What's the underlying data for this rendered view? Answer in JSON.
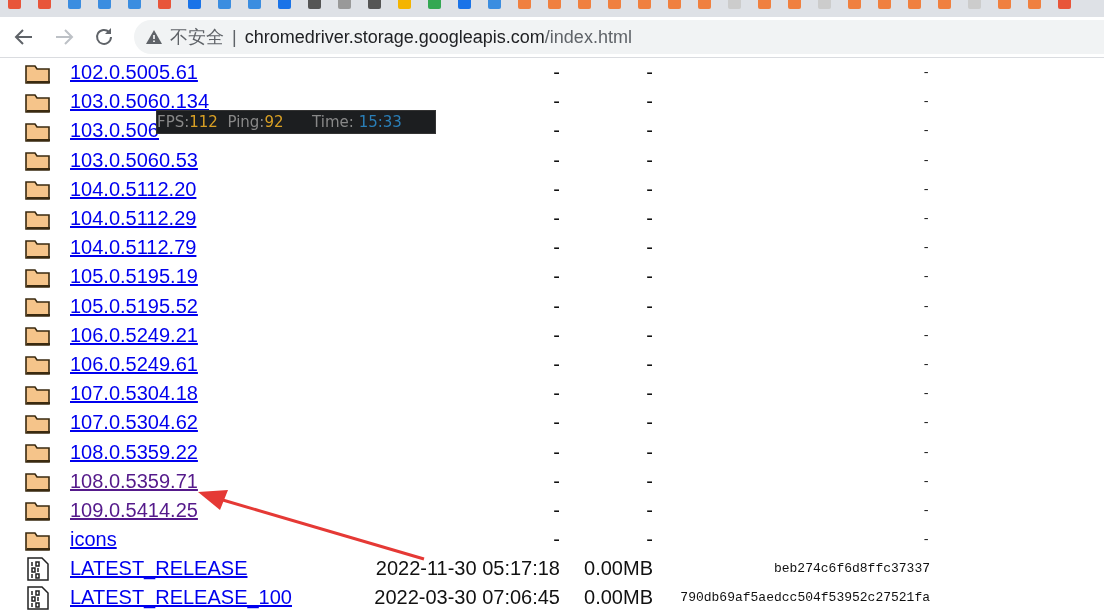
{
  "toolbar": {
    "security_label": "不安全",
    "separator": "|",
    "url_host": "chromedriver.storage.googleapis.com",
    "url_path": "/index.html"
  },
  "rows": [
    {
      "kind": "folder",
      "name": "102.0.5005.61",
      "visited": false,
      "modified": "-",
      "size": "-",
      "hash": "-"
    },
    {
      "kind": "folder",
      "name": "103.0.5060.134",
      "visited": false,
      "modified": "-",
      "size": "-",
      "hash": "-"
    },
    {
      "kind": "folder",
      "name": "103.0.506",
      "visited": false,
      "modified": "-",
      "size": "-",
      "hash": "-"
    },
    {
      "kind": "folder",
      "name": "103.0.5060.53",
      "visited": false,
      "modified": "-",
      "size": "-",
      "hash": "-"
    },
    {
      "kind": "folder",
      "name": "104.0.5112.20",
      "visited": false,
      "modified": "-",
      "size": "-",
      "hash": "-"
    },
    {
      "kind": "folder",
      "name": "104.0.5112.29",
      "visited": false,
      "modified": "-",
      "size": "-",
      "hash": "-"
    },
    {
      "kind": "folder",
      "name": "104.0.5112.79",
      "visited": false,
      "modified": "-",
      "size": "-",
      "hash": "-"
    },
    {
      "kind": "folder",
      "name": "105.0.5195.19",
      "visited": false,
      "modified": "-",
      "size": "-",
      "hash": "-"
    },
    {
      "kind": "folder",
      "name": "105.0.5195.52",
      "visited": false,
      "modified": "-",
      "size": "-",
      "hash": "-"
    },
    {
      "kind": "folder",
      "name": "106.0.5249.21",
      "visited": false,
      "modified": "-",
      "size": "-",
      "hash": "-"
    },
    {
      "kind": "folder",
      "name": "106.0.5249.61",
      "visited": false,
      "modified": "-",
      "size": "-",
      "hash": "-"
    },
    {
      "kind": "folder",
      "name": "107.0.5304.18",
      "visited": false,
      "modified": "-",
      "size": "-",
      "hash": "-"
    },
    {
      "kind": "folder",
      "name": "107.0.5304.62",
      "visited": false,
      "modified": "-",
      "size": "-",
      "hash": "-"
    },
    {
      "kind": "folder",
      "name": "108.0.5359.22",
      "visited": false,
      "modified": "-",
      "size": "-",
      "hash": "-"
    },
    {
      "kind": "folder",
      "name": "108.0.5359.71",
      "visited": true,
      "modified": "-",
      "size": "-",
      "hash": "-"
    },
    {
      "kind": "folder",
      "name": "109.0.5414.25",
      "visited": true,
      "modified": "-",
      "size": "-",
      "hash": "-"
    },
    {
      "kind": "folder",
      "name": "icons",
      "visited": false,
      "modified": "-",
      "size": "-",
      "hash": "-"
    },
    {
      "kind": "file",
      "name": "LATEST_RELEASE",
      "visited": false,
      "modified": "2022-11-30 05:17:18",
      "size": "0.00MB",
      "hash": "beb274c6f6d8ffc37337"
    },
    {
      "kind": "file",
      "name": "LATEST_RELEASE_100",
      "visited": false,
      "modified": "2022-03-30 07:06:45",
      "size": "0.00MB",
      "hash": "790db69af5aedcc504f53952c27521fa"
    }
  ],
  "overlay": {
    "fps_label": "FPS:",
    "fps": "112",
    "ping_label": "Ping:",
    "ping": "92",
    "time_label": "Time:",
    "time": "15:33"
  }
}
